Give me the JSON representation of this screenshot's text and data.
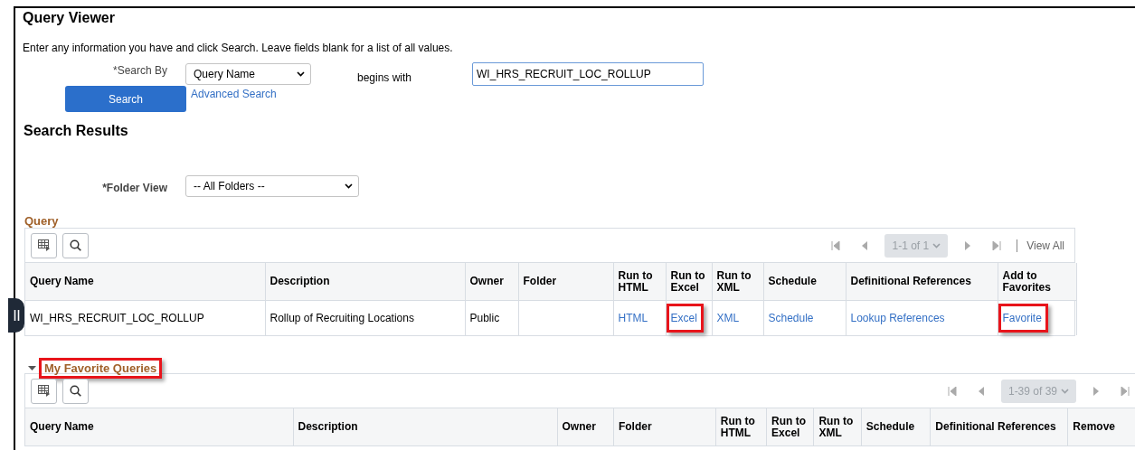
{
  "title": "Query Viewer",
  "instructions": "Enter any information you have and click Search. Leave fields blank for a list of all values.",
  "search_by": {
    "label": "*Search By",
    "value": "Query Name",
    "operator": "begins with",
    "term": "WI_HRS_RECRUIT_LOC_ROLLUP"
  },
  "search_button": "Search",
  "advanced_search": "Advanced Search",
  "results_title": "Search Results",
  "folder_view": {
    "label": "*Folder View",
    "value": "-- All Folders --"
  },
  "grids": [
    {
      "title": "Query",
      "highlighted": false,
      "pager": "1-1 of 1",
      "view_all": "View All",
      "columns": [
        "Query Name",
        "Description",
        "Owner",
        "Folder",
        "Run to HTML",
        "Run to Excel",
        "Run to XML",
        "Schedule",
        "Definitional References",
        "Add to Favorites"
      ],
      "rows": [
        {
          "cells": [
            {
              "text": "WI_HRS_RECRUIT_LOC_ROLLUP",
              "kind": "text"
            },
            {
              "text": "Rollup of Recruiting Locations",
              "kind": "text"
            },
            {
              "text": "Public",
              "kind": "text"
            },
            {
              "kind": "empty"
            },
            {
              "text": "HTML",
              "kind": "link",
              "highlighted": false
            },
            {
              "text": "Excel",
              "kind": "link",
              "highlighted": true
            },
            {
              "text": "XML",
              "kind": "link",
              "highlighted": false
            },
            {
              "text": "Schedule",
              "kind": "link",
              "highlighted": false
            },
            {
              "text": "Lookup References",
              "kind": "link",
              "highlighted": false
            },
            {
              "text": "Favorite",
              "kind": "link",
              "highlighted": true
            }
          ]
        }
      ]
    },
    {
      "title": "My Favorite Queries",
      "highlighted": true,
      "expanded": true,
      "pager": "1-39 of 39",
      "columns": [
        "Query Name",
        "Description",
        "Owner",
        "Folder",
        "Run to HTML",
        "Run to Excel",
        "Run to XML",
        "Schedule",
        "Definitional References",
        "Remove"
      ]
    }
  ]
}
